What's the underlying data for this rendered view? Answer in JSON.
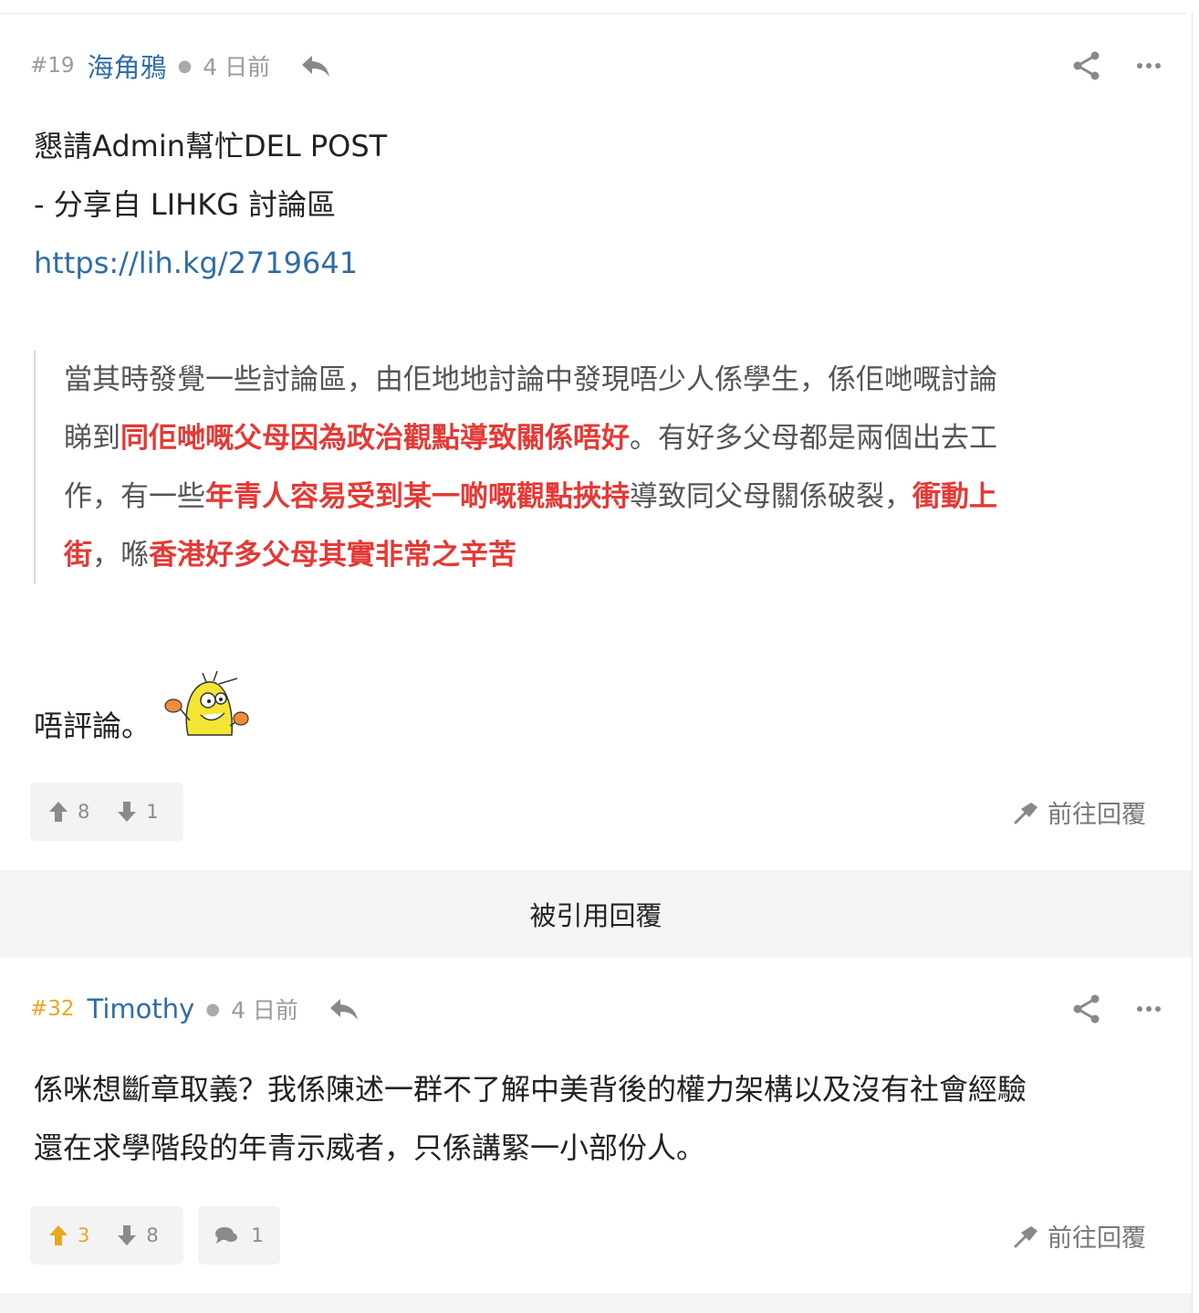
{
  "posts": [
    {
      "num": "#19",
      "author": "海角鴉",
      "time": "4 日前",
      "lines": [
        "懇請Admin幫忙DEL POST",
        "- 分享自 LIHKG 討論區"
      ],
      "link": "https://lih.kg/2719641",
      "quote": {
        "p1": "當其時發覺一些討論區，由佢地地討論中發現唔少人係學生，係佢哋嘅討論",
        "p2a": "睇到",
        "p2b": "同佢哋嘅父母因為政治觀點導致關係唔好",
        "p2c": "。有好多父母都是兩個出去工",
        "p3a": "作，有一些",
        "p3b": "年青人容易受到某一啲嘅觀點挾持",
        "p3c": "導致同父母關係破裂，",
        "p3d": "衝動上",
        "p4a": "街",
        "p4b": "，喺",
        "p4c": "香港好多父母其實非常之辛苦"
      },
      "remark": "唔評論。",
      "upvotes": "8",
      "downvotes": "1",
      "goto_label": "前往回覆"
    },
    {
      "num": "#32",
      "author": "Timothy",
      "time": "4 日前",
      "lines": [
        "係咪想斷章取義？我係陳述一群不了解中美背後的權力架構以及沒有社會經驗",
        "還在求學階段的年青示威者，只係講緊一小部份人。"
      ],
      "upvotes": "3",
      "downvotes": "8",
      "comments": "1",
      "goto_label": "前往回覆"
    }
  ],
  "quoted_replies_label": "被引用回覆",
  "colors": {
    "link": "#2f6da6",
    "highlight": "#e53935",
    "gold": "#e8a81b"
  },
  "icons": [
    "reply-icon",
    "share-icon",
    "more-icon",
    "upvote-icon",
    "downvote-icon",
    "comment-icon",
    "goto-reply-icon",
    "emoji-sticker"
  ]
}
